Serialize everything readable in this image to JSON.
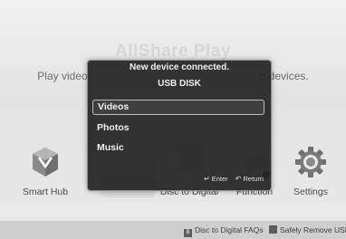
{
  "background": {
    "title": "AllShare Play",
    "subtitle_left": "Play video",
    "subtitle_right": "d devices."
  },
  "apps": [
    {
      "label": "Smart Hub",
      "icon": "smart-hub-cube-icon"
    },
    {
      "label": "Disc to Digital",
      "icon": "disc-to-digital-icon"
    },
    {
      "label": "Function",
      "icon": "function-icon"
    },
    {
      "label": "Settings",
      "icon": "gear-icon"
    }
  ],
  "bottom_bar": {
    "faq_key": "B",
    "faq_label": "Disc to Digital FAQs",
    "safe_remove_label": "Safely Remove USB"
  },
  "dialog": {
    "message": "New device connected.",
    "device": "USB DISK",
    "items": [
      "Videos",
      "Photos",
      "Music"
    ],
    "selected": "Videos",
    "enter_hint": "Enter",
    "return_hint": "Return"
  },
  "colors": {
    "dialog_bg": "#232323",
    "screen_bg": "#e6e6e6",
    "bottom_bar_bg": "#cfcfcf"
  }
}
